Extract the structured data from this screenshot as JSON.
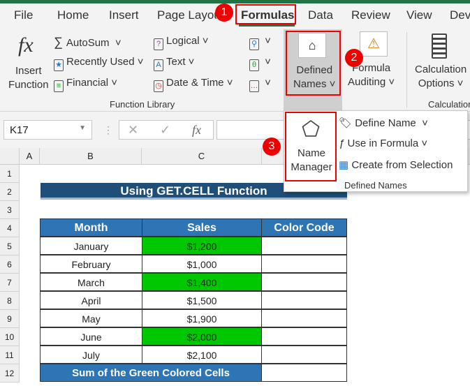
{
  "tabs": [
    "File",
    "Home",
    "Insert",
    "Page Layout",
    "Formulas",
    "Data",
    "Review",
    "View",
    "Dev"
  ],
  "ribbon": {
    "insert_function": [
      "Insert",
      "Function"
    ],
    "autosum": "AutoSum",
    "recently_used": "Recently Used",
    "financial": "Financial",
    "logical": "Logical",
    "text": "Text",
    "date_time": "Date & Time",
    "defined_names": [
      "Defined",
      "Names"
    ],
    "formula_auditing": [
      "Formula",
      "Auditing"
    ],
    "calculation_options": [
      "Calculation",
      "Options"
    ],
    "group_function_library": "Function Library",
    "group_calculation": "Calculation"
  },
  "badges": [
    "1",
    "2",
    "3"
  ],
  "formula_bar": {
    "name_box": "K17",
    "fx": "fx"
  },
  "dropdown": {
    "name_manager": [
      "Name",
      "Manager"
    ],
    "define_name": "Define Name",
    "use_in_formula": "Use in Formula",
    "create_from_selection": "Create from Selection",
    "group": "Defined Names"
  },
  "columns": [
    "A",
    "B",
    "C"
  ],
  "rows": [
    "1",
    "2",
    "3",
    "4",
    "5",
    "6",
    "7",
    "8",
    "9",
    "10",
    "11",
    "12"
  ],
  "sheet": {
    "title": "Using GET.CELL Function",
    "headers": [
      "Month",
      "Sales",
      "Color Code"
    ],
    "data": [
      [
        "January",
        "$1,200",
        true
      ],
      [
        "February",
        "$1,000",
        false
      ],
      [
        "March",
        "$1,400",
        true
      ],
      [
        "April",
        "$1,500",
        false
      ],
      [
        "May",
        "$1,900",
        false
      ],
      [
        "June",
        "$2,000",
        true
      ],
      [
        "July",
        "$2,100",
        false
      ]
    ],
    "footer": "Sum of the Green Colored Cells"
  },
  "colors": {
    "header": "#2e75b6",
    "title": "#1f4e79",
    "green": "#00c800",
    "badge": "#e00000"
  }
}
